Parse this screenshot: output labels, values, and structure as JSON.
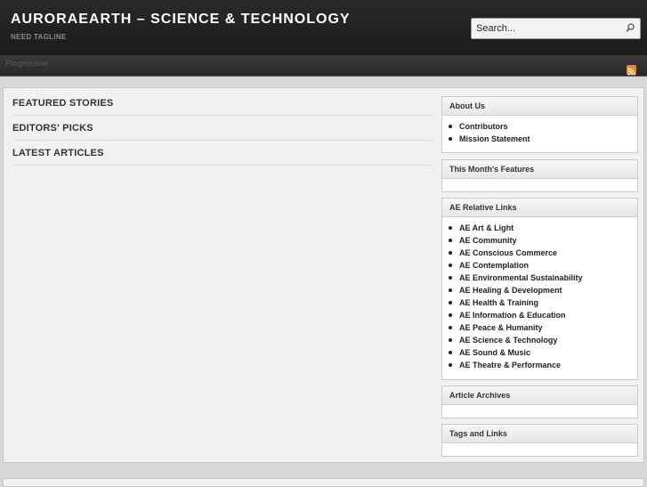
{
  "header": {
    "title": "AURORAEARTH – SCIENCE & TECHNOLOGY",
    "tagline": "NEED TAGLINE",
    "search_placeholder": "Search...",
    "nav_ghost_text": "Progressive"
  },
  "main": {
    "sections": [
      "FEATURED STORIES",
      "EDITORS' PICKS",
      "LATEST ARTICLES"
    ]
  },
  "sidebar": {
    "about_us": {
      "title": "About Us",
      "items": [
        "Contributors",
        "Mission Statement"
      ]
    },
    "month_features": {
      "title": "This Month's Features"
    },
    "relative_links": {
      "title": "AE Relative Links",
      "items": [
        "AE Art & Light",
        "AE Community",
        "AE Conscious Commerce",
        "AE Contemplation",
        "AE Environmental Sustainability",
        "AE Healing & Development",
        "AE Health & Training",
        "AE Information & Education",
        "AE Peace & Humanity",
        "AE Science & Technology",
        "AE Sound & Music",
        "AE Theatre & Performance"
      ]
    },
    "archives": {
      "title": "Article Archives"
    },
    "tags": {
      "title": "Tags and Links"
    }
  },
  "colors": {
    "header_bg": "#1c1b1a",
    "rss": "#e88a2a",
    "content_bg": "#f1f1f1"
  },
  "icons": {
    "search": "search-icon",
    "rss": "rss-icon"
  }
}
